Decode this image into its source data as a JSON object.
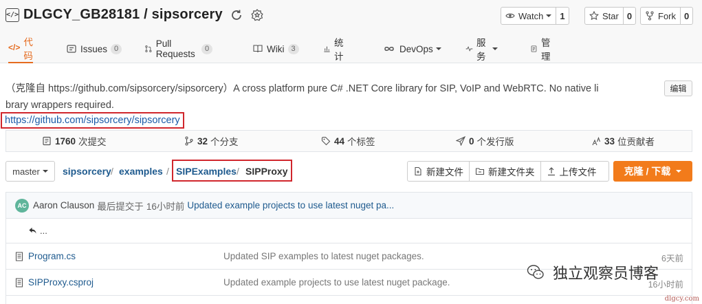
{
  "repo": {
    "name": "DLGCY_GB28181 / sipsorcery",
    "icon": "repo-icon"
  },
  "actions": [
    {
      "label": "Watch",
      "count": "1",
      "icon": "eye-icon"
    },
    {
      "label": "Star",
      "count": "0",
      "icon": "star-icon"
    },
    {
      "label": "Fork",
      "count": "0",
      "icon": "fork-icon"
    }
  ],
  "tabs": [
    {
      "label": "代码",
      "icon": "code-icon",
      "active": true
    },
    {
      "label": "Issues",
      "badge": "0",
      "icon": "issues-icon"
    },
    {
      "label": "Pull Requests",
      "badge": "0",
      "icon": "pull-request-icon"
    },
    {
      "label": "Wiki",
      "badge": "3",
      "icon": "wiki-icon"
    },
    {
      "label": "统计",
      "icon": "chart-icon"
    },
    {
      "label": "DevOps",
      "icon": "devops-icon"
    },
    {
      "label": "服务",
      "icon": "service-icon"
    },
    {
      "label": "管理",
      "icon": "manage-icon"
    }
  ],
  "description": {
    "text": "（克隆自 https://github.com/sipsorcery/sipsorcery）A cross platform pure C# .NET Core library for SIP, VoIP and WebRTC. No native libraryl wrappers required.",
    "line1": "（克隆自 https://github.com/sipsorcery/sipsorcery）A cross platform pure C# .NET Core library for SIP, VoIP and WebRTC. No native li",
    "line2": "brary wrappers required.",
    "edit_label": "编辑",
    "homepage": "https://github.com/sipsorcery/sipsorcery"
  },
  "stats": [
    {
      "value": "1760",
      "label": "次提交",
      "icon": "commit-icon"
    },
    {
      "value": "32",
      "label": "个分支",
      "icon": "branch-icon"
    },
    {
      "value": "44",
      "label": "个标签",
      "icon": "tag-icon"
    },
    {
      "value": "0",
      "label": "个发行版",
      "icon": "release-icon"
    },
    {
      "value": "33",
      "label": "位贡献者",
      "icon": "contributors-icon"
    }
  ],
  "branch": "master",
  "breadcrumb": [
    "sipsorcery",
    "examples",
    "SIPExamples",
    "SIPProxy"
  ],
  "file_actions": [
    "新建文件",
    "新建文件夹",
    "上传文件"
  ],
  "clone_label": "克隆 / 下载",
  "latest_commit": {
    "avatar": "AC",
    "author": "Aaron Clauson",
    "label": "最后提交于",
    "time": "16小时前",
    "message": "Updated example projects to use latest nuget pa..."
  },
  "back_label": "...",
  "files": [
    {
      "name": "Program.cs",
      "message": "Updated SIP examples to latest nuget packages.",
      "time": "6天前"
    },
    {
      "name": "SIPProxy.csproj",
      "message": "Updated example projects to use latest nuget package.",
      "time": "16小时前"
    }
  ],
  "watermark": "独立观察员博客",
  "site_mark": "dlgcy.com",
  "colors": {
    "accent": "#f27b1b",
    "link": "#1e5a8e",
    "highlight": "#d0262c"
  }
}
